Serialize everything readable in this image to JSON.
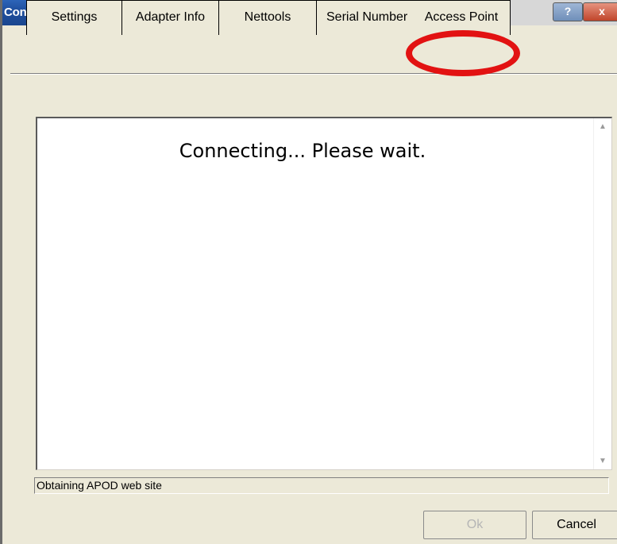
{
  "window": {
    "title": "Connection Wizard",
    "help_label": "?",
    "close_label": "x"
  },
  "tabs": [
    {
      "label": "Settings"
    },
    {
      "label": "Adapter Info"
    },
    {
      "label": "Nettools"
    },
    {
      "label": "Serial Number"
    },
    {
      "label": "Access Point"
    }
  ],
  "content": {
    "message": "Connecting... Please wait."
  },
  "status": {
    "text": "Obtaining APOD web site"
  },
  "buttons": {
    "ok_label": "Ok",
    "cancel_label": "Cancel"
  },
  "colors": {
    "highlight_ring": "#e21212",
    "titlebar": "#1f4f9e"
  }
}
